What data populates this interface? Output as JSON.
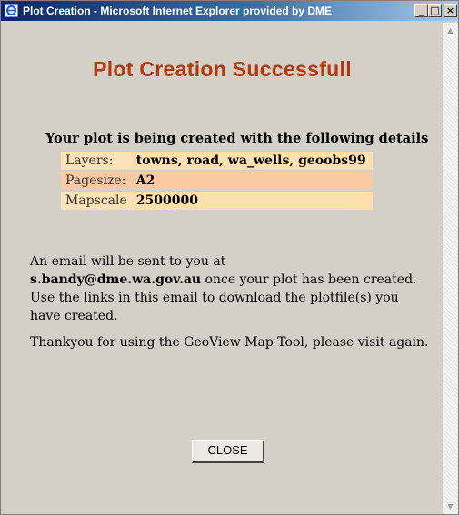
{
  "window": {
    "title": "Plot Creation - Microsoft Internet Explorer provided by DME",
    "icon": "ie-icon",
    "controls": {
      "minimize": "_",
      "maximize": "□",
      "close": "×"
    }
  },
  "page": {
    "heading": "Plot Creation Successfull",
    "intro": "Your plot is being created with the following details",
    "details": [
      {
        "label": "Layers:",
        "value": "towns, road, wa_wells, geoobs99"
      },
      {
        "label": "Pagesize:",
        "value": "A2"
      },
      {
        "label": "Mapscale",
        "value": "2500000"
      }
    ],
    "email_notice": {
      "before": "An email will be sent to you at",
      "email": "s.bandy@dme.wa.gov.au",
      "after": " once your plot has been created. Use the links in this email to download the plotfile(s) you have created."
    },
    "thanks": "Thankyou for using the GeoView Map Tool, please visit again.",
    "close_button": "CLOSE"
  },
  "scrollbar": {
    "up_arrow": "▲",
    "down_arrow": "▼"
  },
  "colors": {
    "heading": "#b5380d",
    "titlebar": "#0a246a",
    "row_light": "#fde0b0",
    "row_dark": "#fbc9a4"
  }
}
